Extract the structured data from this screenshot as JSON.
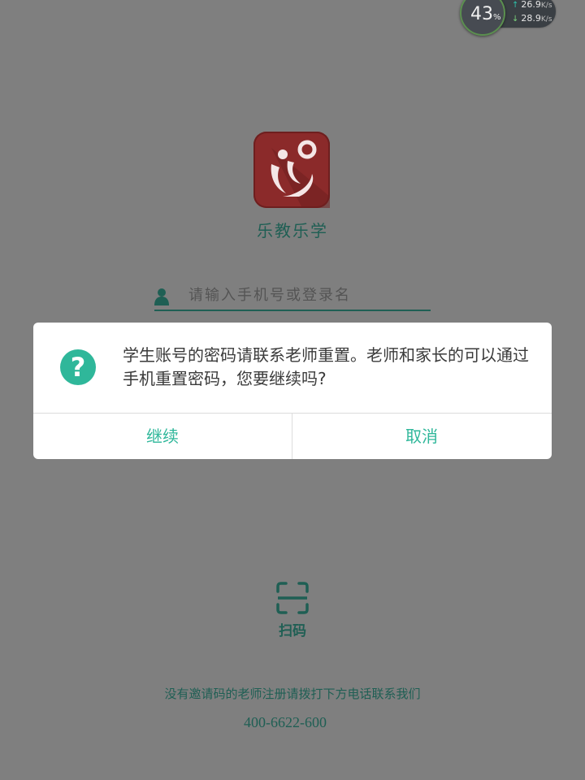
{
  "status_widget": {
    "battery_percent": "43",
    "percent_sign": "%",
    "upload_speed": "26.9",
    "download_speed": "28.9",
    "speed_unit": "K/s",
    "upload_arrow": "↑",
    "download_arrow": "↓"
  },
  "app": {
    "name": "乐教乐学",
    "logo_color": "#8b2a2a"
  },
  "login": {
    "username_placeholder": "请输入手机号或登录名",
    "username_value": "",
    "field_icon": "person-icon"
  },
  "dialog": {
    "icon": "question-icon",
    "icon_glyph": "?",
    "message": "学生账号的密码请联系老师重置。老师和家长的可以通过手机重置密码，您要继续吗?",
    "continue_label": "继续",
    "cancel_label": "取消",
    "accent_color": "#2fb79a"
  },
  "scan": {
    "icon": "scan-icon",
    "label": "扫码"
  },
  "footer": {
    "note": "没有邀请码的老师注册请拨打下方电话联系我们",
    "phone": "400-6622-600"
  },
  "colors": {
    "overlay_background": "#7f7f7f",
    "brand_text": "#1f5f54"
  }
}
